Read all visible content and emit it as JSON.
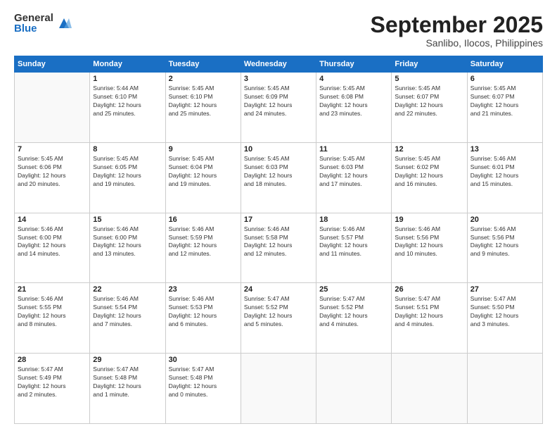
{
  "logo": {
    "general": "General",
    "blue": "Blue"
  },
  "header": {
    "month": "September 2025",
    "location": "Sanlibo, Ilocos, Philippines"
  },
  "weekdays": [
    "Sunday",
    "Monday",
    "Tuesday",
    "Wednesday",
    "Thursday",
    "Friday",
    "Saturday"
  ],
  "weeks": [
    [
      {
        "day": "",
        "info": ""
      },
      {
        "day": "1",
        "info": "Sunrise: 5:44 AM\nSunset: 6:10 PM\nDaylight: 12 hours\nand 25 minutes."
      },
      {
        "day": "2",
        "info": "Sunrise: 5:45 AM\nSunset: 6:10 PM\nDaylight: 12 hours\nand 25 minutes."
      },
      {
        "day": "3",
        "info": "Sunrise: 5:45 AM\nSunset: 6:09 PM\nDaylight: 12 hours\nand 24 minutes."
      },
      {
        "day": "4",
        "info": "Sunrise: 5:45 AM\nSunset: 6:08 PM\nDaylight: 12 hours\nand 23 minutes."
      },
      {
        "day": "5",
        "info": "Sunrise: 5:45 AM\nSunset: 6:07 PM\nDaylight: 12 hours\nand 22 minutes."
      },
      {
        "day": "6",
        "info": "Sunrise: 5:45 AM\nSunset: 6:07 PM\nDaylight: 12 hours\nand 21 minutes."
      }
    ],
    [
      {
        "day": "7",
        "info": "Sunrise: 5:45 AM\nSunset: 6:06 PM\nDaylight: 12 hours\nand 20 minutes."
      },
      {
        "day": "8",
        "info": "Sunrise: 5:45 AM\nSunset: 6:05 PM\nDaylight: 12 hours\nand 19 minutes."
      },
      {
        "day": "9",
        "info": "Sunrise: 5:45 AM\nSunset: 6:04 PM\nDaylight: 12 hours\nand 19 minutes."
      },
      {
        "day": "10",
        "info": "Sunrise: 5:45 AM\nSunset: 6:03 PM\nDaylight: 12 hours\nand 18 minutes."
      },
      {
        "day": "11",
        "info": "Sunrise: 5:45 AM\nSunset: 6:03 PM\nDaylight: 12 hours\nand 17 minutes."
      },
      {
        "day": "12",
        "info": "Sunrise: 5:45 AM\nSunset: 6:02 PM\nDaylight: 12 hours\nand 16 minutes."
      },
      {
        "day": "13",
        "info": "Sunrise: 5:46 AM\nSunset: 6:01 PM\nDaylight: 12 hours\nand 15 minutes."
      }
    ],
    [
      {
        "day": "14",
        "info": "Sunrise: 5:46 AM\nSunset: 6:00 PM\nDaylight: 12 hours\nand 14 minutes."
      },
      {
        "day": "15",
        "info": "Sunrise: 5:46 AM\nSunset: 6:00 PM\nDaylight: 12 hours\nand 13 minutes."
      },
      {
        "day": "16",
        "info": "Sunrise: 5:46 AM\nSunset: 5:59 PM\nDaylight: 12 hours\nand 12 minutes."
      },
      {
        "day": "17",
        "info": "Sunrise: 5:46 AM\nSunset: 5:58 PM\nDaylight: 12 hours\nand 12 minutes."
      },
      {
        "day": "18",
        "info": "Sunrise: 5:46 AM\nSunset: 5:57 PM\nDaylight: 12 hours\nand 11 minutes."
      },
      {
        "day": "19",
        "info": "Sunrise: 5:46 AM\nSunset: 5:56 PM\nDaylight: 12 hours\nand 10 minutes."
      },
      {
        "day": "20",
        "info": "Sunrise: 5:46 AM\nSunset: 5:56 PM\nDaylight: 12 hours\nand 9 minutes."
      }
    ],
    [
      {
        "day": "21",
        "info": "Sunrise: 5:46 AM\nSunset: 5:55 PM\nDaylight: 12 hours\nand 8 minutes."
      },
      {
        "day": "22",
        "info": "Sunrise: 5:46 AM\nSunset: 5:54 PM\nDaylight: 12 hours\nand 7 minutes."
      },
      {
        "day": "23",
        "info": "Sunrise: 5:46 AM\nSunset: 5:53 PM\nDaylight: 12 hours\nand 6 minutes."
      },
      {
        "day": "24",
        "info": "Sunrise: 5:47 AM\nSunset: 5:52 PM\nDaylight: 12 hours\nand 5 minutes."
      },
      {
        "day": "25",
        "info": "Sunrise: 5:47 AM\nSunset: 5:52 PM\nDaylight: 12 hours\nand 4 minutes."
      },
      {
        "day": "26",
        "info": "Sunrise: 5:47 AM\nSunset: 5:51 PM\nDaylight: 12 hours\nand 4 minutes."
      },
      {
        "day": "27",
        "info": "Sunrise: 5:47 AM\nSunset: 5:50 PM\nDaylight: 12 hours\nand 3 minutes."
      }
    ],
    [
      {
        "day": "28",
        "info": "Sunrise: 5:47 AM\nSunset: 5:49 PM\nDaylight: 12 hours\nand 2 minutes."
      },
      {
        "day": "29",
        "info": "Sunrise: 5:47 AM\nSunset: 5:48 PM\nDaylight: 12 hours\nand 1 minute."
      },
      {
        "day": "30",
        "info": "Sunrise: 5:47 AM\nSunset: 5:48 PM\nDaylight: 12 hours\nand 0 minutes."
      },
      {
        "day": "",
        "info": ""
      },
      {
        "day": "",
        "info": ""
      },
      {
        "day": "",
        "info": ""
      },
      {
        "day": "",
        "info": ""
      }
    ]
  ]
}
